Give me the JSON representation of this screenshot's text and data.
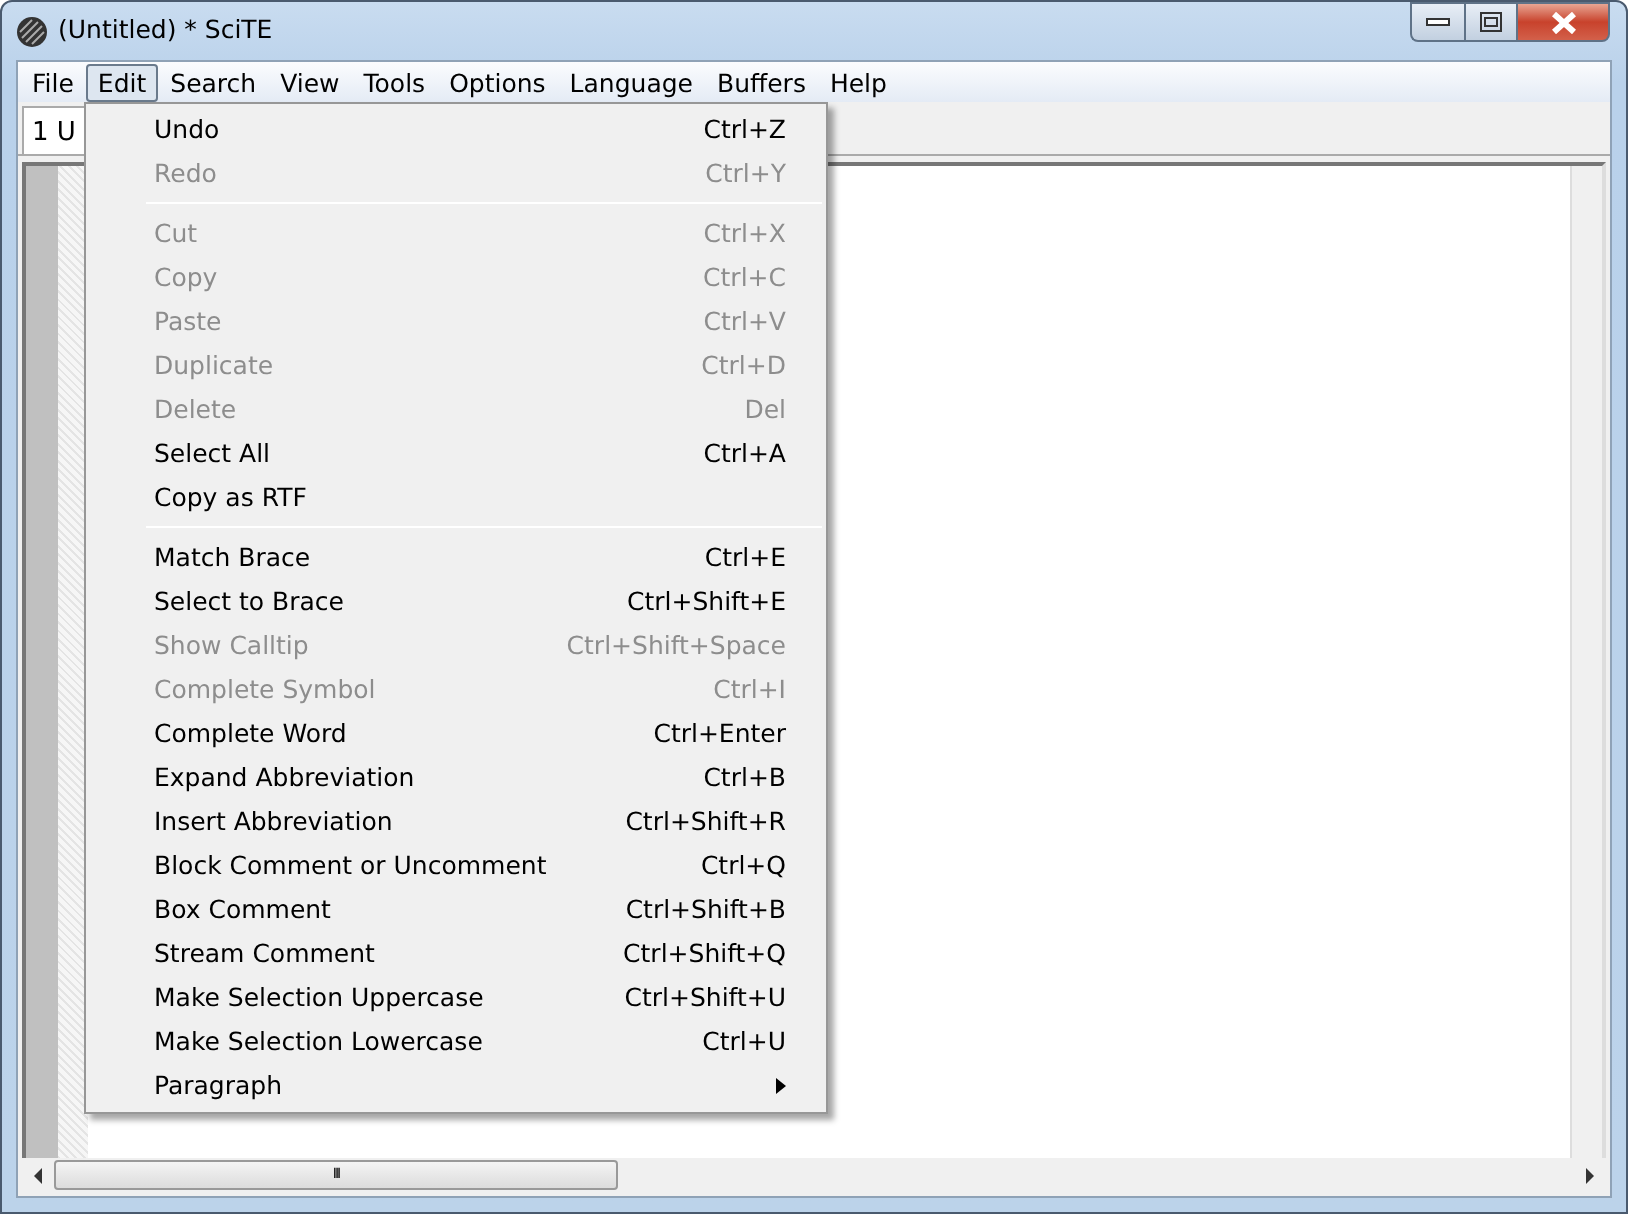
{
  "window": {
    "title": "(Untitled) * SciTE"
  },
  "menubar": [
    {
      "label": "File",
      "selected": false
    },
    {
      "label": "Edit",
      "selected": true
    },
    {
      "label": "Search",
      "selected": false
    },
    {
      "label": "View",
      "selected": false
    },
    {
      "label": "Tools",
      "selected": false
    },
    {
      "label": "Options",
      "selected": false
    },
    {
      "label": "Language",
      "selected": false
    },
    {
      "label": "Buffers",
      "selected": false
    },
    {
      "label": "Help",
      "selected": false
    }
  ],
  "tabs": [
    {
      "label": "1 U"
    }
  ],
  "edit_menu": [
    {
      "kind": "item",
      "label": "Undo",
      "shortcut": "Ctrl+Z",
      "disabled": false
    },
    {
      "kind": "item",
      "label": "Redo",
      "shortcut": "Ctrl+Y",
      "disabled": true
    },
    {
      "kind": "separator"
    },
    {
      "kind": "item",
      "label": "Cut",
      "shortcut": "Ctrl+X",
      "disabled": true
    },
    {
      "kind": "item",
      "label": "Copy",
      "shortcut": "Ctrl+C",
      "disabled": true
    },
    {
      "kind": "item",
      "label": "Paste",
      "shortcut": "Ctrl+V",
      "disabled": true
    },
    {
      "kind": "item",
      "label": "Duplicate",
      "shortcut": "Ctrl+D",
      "disabled": true
    },
    {
      "kind": "item",
      "label": "Delete",
      "shortcut": "Del",
      "disabled": true
    },
    {
      "kind": "item",
      "label": "Select All",
      "shortcut": "Ctrl+A",
      "disabled": false
    },
    {
      "kind": "item",
      "label": "Copy as RTF",
      "disabled": false
    },
    {
      "kind": "separator"
    },
    {
      "kind": "item",
      "label": "Match Brace",
      "shortcut": "Ctrl+E",
      "disabled": false
    },
    {
      "kind": "item",
      "label": "Select to Brace",
      "shortcut": "Ctrl+Shift+E",
      "disabled": false
    },
    {
      "kind": "item",
      "label": "Show Calltip",
      "shortcut": "Ctrl+Shift+Space",
      "disabled": true
    },
    {
      "kind": "item",
      "label": "Complete Symbol",
      "shortcut": "Ctrl+I",
      "disabled": true
    },
    {
      "kind": "item",
      "label": "Complete Word",
      "shortcut": "Ctrl+Enter",
      "disabled": false
    },
    {
      "kind": "item",
      "label": "Expand Abbreviation",
      "shortcut": "Ctrl+B",
      "disabled": false
    },
    {
      "kind": "item",
      "label": "Insert Abbreviation",
      "shortcut": "Ctrl+Shift+R",
      "disabled": false
    },
    {
      "kind": "item",
      "label": "Block Comment or Uncomment",
      "shortcut": "Ctrl+Q",
      "disabled": false
    },
    {
      "kind": "item",
      "label": "Box Comment",
      "shortcut": "Ctrl+Shift+B",
      "disabled": false
    },
    {
      "kind": "item",
      "label": "Stream Comment",
      "shortcut": "Ctrl+Shift+Q",
      "disabled": false
    },
    {
      "kind": "item",
      "label": "Make Selection Uppercase",
      "shortcut": "Ctrl+Shift+U",
      "disabled": false
    },
    {
      "kind": "item",
      "label": "Make Selection Lowercase",
      "shortcut": "Ctrl+U",
      "disabled": false
    },
    {
      "kind": "submenu",
      "label": "Paragraph",
      "disabled": false
    }
  ],
  "scrollbar": {
    "grip": "III"
  }
}
